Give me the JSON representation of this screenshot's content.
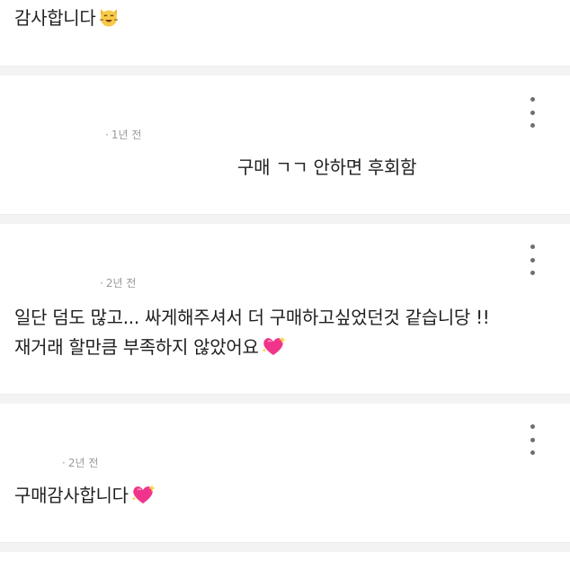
{
  "reviews": [
    {
      "text": "감사합니다",
      "emoji": "cat-face-emoji"
    },
    {
      "time": "1년 전",
      "text": "구매 ㄱㄱ 안하면 후회함"
    },
    {
      "time": "2년 전",
      "line1": "일단 덤도 많고... 싸게해주셔서 더 구매하고싶었던것 같습니당 !!",
      "line2": "재거래 할만큼 부족하지 않았어요",
      "emoji": "sparkling-heart-emoji"
    },
    {
      "time": "2년 전",
      "text": "구매감사합니다",
      "emoji": "sparkling-heart-emoji"
    }
  ],
  "colors": {
    "text": "#1f1f1f",
    "meta": "#9a9a9a",
    "divider": "#f3f3f3",
    "menu_dots": "#6f6f6f"
  },
  "icons": [
    "more-vertical-icon"
  ]
}
